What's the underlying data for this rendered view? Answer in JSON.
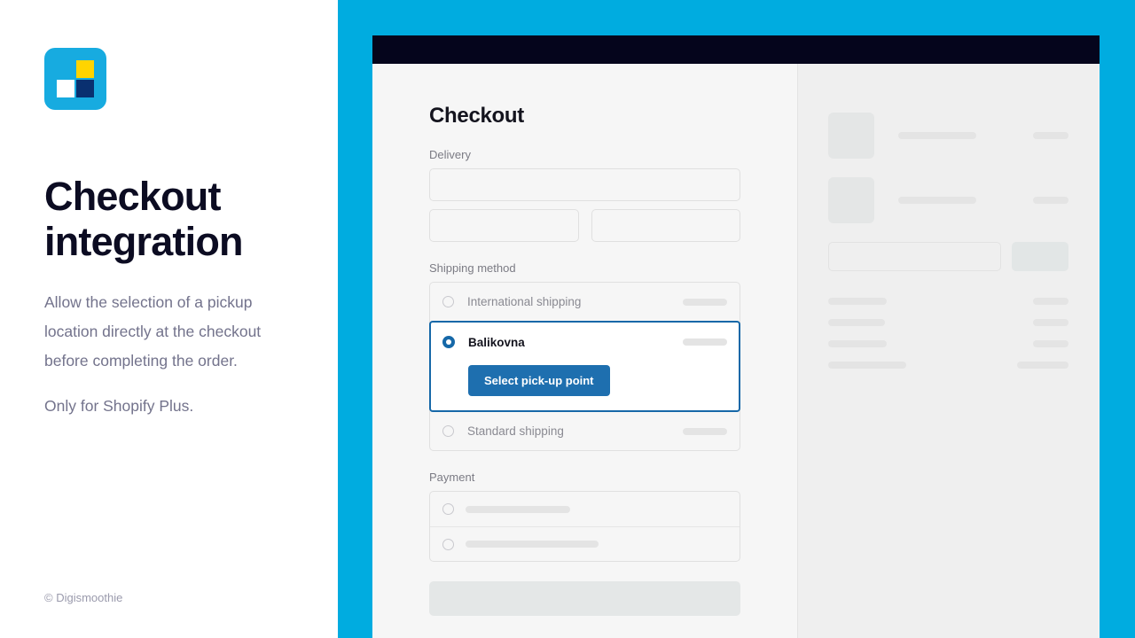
{
  "brand": {
    "logo_name": "digismoothie-logo",
    "logo_bg": "#17ABE0",
    "logo_yellow": "#FFD400",
    "logo_white": "#FFFFFF",
    "logo_navy": "#093070"
  },
  "marketing": {
    "headline_line1": "Checkout",
    "headline_line2": "integration",
    "paragraph1": "Allow the selection of a pickup location directly at the checkout before completing the order.",
    "paragraph2": "Only for Shopify Plus.",
    "copyright": "© Digismoothie"
  },
  "theme": {
    "stage_blue": "#00ACE0",
    "accent_blue": "#1668A8",
    "button_blue": "#1E6FAF",
    "topbar_dark": "#05051C",
    "heading_color": "#0C0C22"
  },
  "checkout": {
    "title": "Checkout",
    "delivery_label": "Delivery",
    "shipping_label": "Shipping method",
    "payment_label": "Payment",
    "delivery_fields": [
      {
        "name": "address-field",
        "value": "",
        "placeholder": ""
      },
      {
        "name": "city-field",
        "value": "",
        "placeholder": ""
      },
      {
        "name": "postal-code-field",
        "value": "",
        "placeholder": ""
      }
    ],
    "shipping_methods": [
      {
        "label": "International shipping",
        "selected": false
      },
      {
        "label": "Balikovna",
        "selected": true
      },
      {
        "label": "Standard shipping",
        "selected": false
      }
    ],
    "pickup_button": "Select pick-up point"
  },
  "summary": {
    "products": [
      {
        "name": "product-line-item"
      },
      {
        "name": "product-line-item"
      }
    ],
    "discount_placeholder": "",
    "totals": [
      {
        "label_width": 66,
        "value_width": 40
      },
      {
        "label_width": 64,
        "value_width": 40
      },
      {
        "label_width": 66,
        "value_width": 40
      },
      {
        "label_width": 88,
        "value_width": 58
      }
    ]
  }
}
